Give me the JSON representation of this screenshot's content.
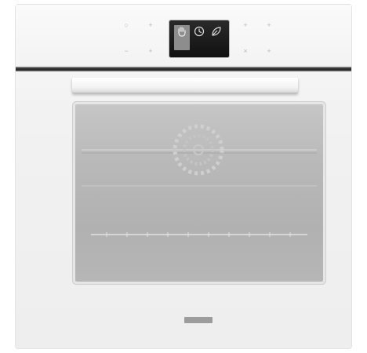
{
  "appliance": {
    "type": "built-in oven",
    "finish_color": "#f2f2f2",
    "glass_color": "#b4b4b4"
  },
  "control_panel": {
    "left_keys": [
      "circle-icon",
      "plus-icon",
      "minus-icon",
      "plus-icon"
    ],
    "right_keys": [
      "plus-icon",
      "plus-icon",
      "close-icon",
      "plus-icon"
    ],
    "display": {
      "modes": [
        {
          "icon": "hand-icon",
          "label": "",
          "selected": true
        },
        {
          "icon": "clock-icon",
          "label": "",
          "selected": false
        },
        {
          "icon": "leaf-icon",
          "label": "",
          "selected": false
        }
      ]
    }
  },
  "brand_badge": {
    "text": ""
  }
}
